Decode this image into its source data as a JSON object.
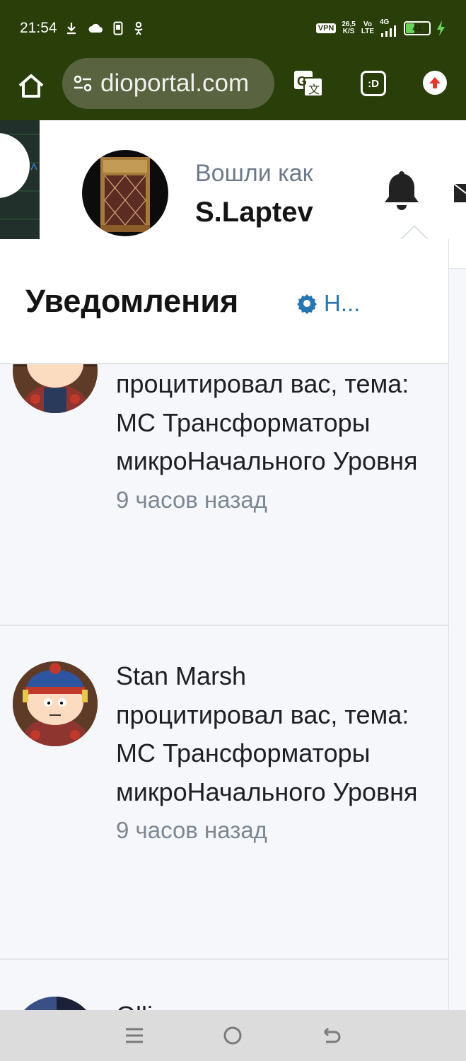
{
  "status_bar": {
    "time": "21:54",
    "net_speed_value": "26,5",
    "net_speed_unit": "K/S",
    "vpn": "VPN",
    "volte_top": "Vo",
    "volte_bottom": "LTE",
    "network": "4G",
    "battery_level": "41"
  },
  "browser": {
    "url": "dioportal.com",
    "extension_label": ":D"
  },
  "header": {
    "logged_in_as": "Вошли как",
    "username": "S.Laptev"
  },
  "notifications_popup": {
    "title": "Уведомления",
    "settings_label": "Н...",
    "items": [
      {
        "text": "процитировал вас, тема: МС Трансформаторы микроНачального Уровня",
        "time": "9 часов назад"
      },
      {
        "text": "Stan Marsh процитировал вас, тема: МС Трансформаторы микроНачального Уровня",
        "time": "9 часов назад"
      },
      {
        "text": "Ollieq процитировал",
        "time": ""
      }
    ]
  },
  "colors": {
    "status_bar_bg": "#2a3e0a",
    "accent_link": "#2577b1",
    "popup_bg": "#f5f7fa"
  }
}
